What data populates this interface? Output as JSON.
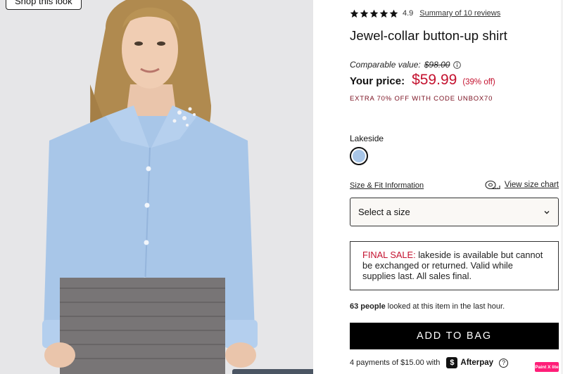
{
  "photo": {
    "shop_look_label": "Shop this look",
    "shirt_color": "#a8c6e8",
    "background_color": "#e6e6e8"
  },
  "product": {
    "rating": "4.9",
    "stars_filled": 5,
    "reviews_link": "Summary of 10 reviews",
    "title": "Jewel-collar button-up shirt",
    "comparable_label": "Comparable value:",
    "comparable_price": "$98.00",
    "price_label": "Your price:",
    "price": "$59.99",
    "discount": "(39% off)",
    "promo": "EXTRA 70% OFF WITH CODE UNBOX70",
    "color_name": "Lakeside",
    "swatch_color": "#a8c6e8",
    "fit_link": "Size & Fit Information",
    "size_chart_link": "View size chart",
    "size_select_placeholder": "Select a size",
    "notice_warn": "FINAL SALE:",
    "notice_text": " lakeside is available but cannot be exchanged or returned. Valid while supplies last. All sales final.",
    "viewers_count": "63 people",
    "viewers_text": " looked at this item in the last hour.",
    "add_to_bag": "ADD TO BAG",
    "payments_text": "4 payments of $15.00 with",
    "afterpay_mark": "$",
    "afterpay_name": "Afterpay",
    "help_glyph": "?",
    "price_color": "#c4122f"
  },
  "overlay": {
    "badge_label": "Paint X lite"
  }
}
